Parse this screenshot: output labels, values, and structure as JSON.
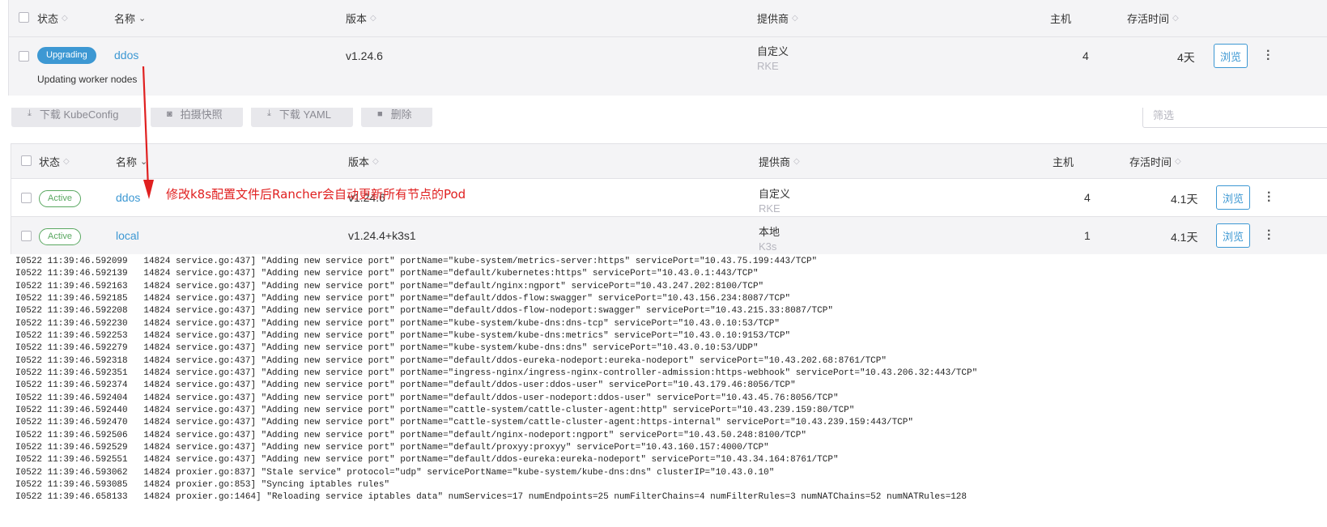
{
  "columns": {
    "status": "状态",
    "name": "名称",
    "version": "版本",
    "provider": "提供商",
    "hosts": "主机",
    "age": "存活时间"
  },
  "top_row": {
    "status": "Upgrading",
    "name": "ddos",
    "version": "v1.24.6",
    "provider": "自定义",
    "provider_sub": "RKE",
    "hosts": "4",
    "age": "4天",
    "browse": "浏览",
    "message": "Updating worker nodes"
  },
  "toolbar": {
    "download_kubeconfig": "下载 KubeConfig",
    "snapshot": "拍摄快照",
    "download_yaml": "下载 YAML",
    "delete": "删除",
    "filter_placeholder": "筛选"
  },
  "clusters": [
    {
      "status": "Active",
      "name": "ddos",
      "version": "v1.24.6",
      "provider": "自定义",
      "provider_sub": "RKE",
      "hosts": "4",
      "age": "4.1天",
      "browse": "浏览"
    },
    {
      "status": "Active",
      "name": "local",
      "version": "v1.24.4+k3s1",
      "provider": "本地",
      "provider_sub": "K3s",
      "hosts": "1",
      "age": "4.1天",
      "browse": "浏览"
    }
  ],
  "annotation": "修改k8s配置文件后Rancher会自动更新所有节点的Pod",
  "colors": {
    "accent": "#3d98d3",
    "active": "#5aa861",
    "annotation": "#e02020"
  },
  "log_lines": [
    "I0522 11:39:46.592099   14824 service.go:437] \"Adding new service port\" portName=\"kube-system/metrics-server:https\" servicePort=\"10.43.75.199:443/TCP\"",
    "I0522 11:39:46.592139   14824 service.go:437] \"Adding new service port\" portName=\"default/kubernetes:https\" servicePort=\"10.43.0.1:443/TCP\"",
    "I0522 11:39:46.592163   14824 service.go:437] \"Adding new service port\" portName=\"default/nginx:ngport\" servicePort=\"10.43.247.202:8100/TCP\"",
    "I0522 11:39:46.592185   14824 service.go:437] \"Adding new service port\" portName=\"default/ddos-flow:swagger\" servicePort=\"10.43.156.234:8087/TCP\"",
    "I0522 11:39:46.592208   14824 service.go:437] \"Adding new service port\" portName=\"default/ddos-flow-nodeport:swagger\" servicePort=\"10.43.215.33:8087/TCP\"",
    "I0522 11:39:46.592230   14824 service.go:437] \"Adding new service port\" portName=\"kube-system/kube-dns:dns-tcp\" servicePort=\"10.43.0.10:53/TCP\"",
    "I0522 11:39:46.592253   14824 service.go:437] \"Adding new service port\" portName=\"kube-system/kube-dns:metrics\" servicePort=\"10.43.0.10:9153/TCP\"",
    "I0522 11:39:46.592279   14824 service.go:437] \"Adding new service port\" portName=\"kube-system/kube-dns:dns\" servicePort=\"10.43.0.10:53/UDP\"",
    "I0522 11:39:46.592318   14824 service.go:437] \"Adding new service port\" portName=\"default/ddos-eureka-nodeport:eureka-nodeport\" servicePort=\"10.43.202.68:8761/TCP\"",
    "I0522 11:39:46.592351   14824 service.go:437] \"Adding new service port\" portName=\"ingress-nginx/ingress-nginx-controller-admission:https-webhook\" servicePort=\"10.43.206.32:443/TCP\"",
    "I0522 11:39:46.592374   14824 service.go:437] \"Adding new service port\" portName=\"default/ddos-user:ddos-user\" servicePort=\"10.43.179.46:8056/TCP\"",
    "I0522 11:39:46.592404   14824 service.go:437] \"Adding new service port\" portName=\"default/ddos-user-nodeport:ddos-user\" servicePort=\"10.43.45.76:8056/TCP\"",
    "I0522 11:39:46.592440   14824 service.go:437] \"Adding new service port\" portName=\"cattle-system/cattle-cluster-agent:http\" servicePort=\"10.43.239.159:80/TCP\"",
    "I0522 11:39:46.592470   14824 service.go:437] \"Adding new service port\" portName=\"cattle-system/cattle-cluster-agent:https-internal\" servicePort=\"10.43.239.159:443/TCP\"",
    "I0522 11:39:46.592506   14824 service.go:437] \"Adding new service port\" portName=\"default/nginx-nodeport:ngport\" servicePort=\"10.43.50.248:8100/TCP\"",
    "I0522 11:39:46.592529   14824 service.go:437] \"Adding new service port\" portName=\"default/proxyy:proxyy\" servicePort=\"10.43.160.157:4000/TCP\"",
    "I0522 11:39:46.592551   14824 service.go:437] \"Adding new service port\" portName=\"default/ddos-eureka:eureka-nodeport\" servicePort=\"10.43.34.164:8761/TCP\"",
    "I0522 11:39:46.593062   14824 proxier.go:837] \"Stale service\" protocol=\"udp\" servicePortName=\"kube-system/kube-dns:dns\" clusterIP=\"10.43.0.10\"",
    "I0522 11:39:46.593085   14824 proxier.go:853] \"Syncing iptables rules\"",
    "I0522 11:39:46.658133   14824 proxier.go:1464] \"Reloading service iptables data\" numServices=17 numEndpoints=25 numFilterChains=4 numFilterRules=3 numNATChains=52 numNATRules=128"
  ]
}
